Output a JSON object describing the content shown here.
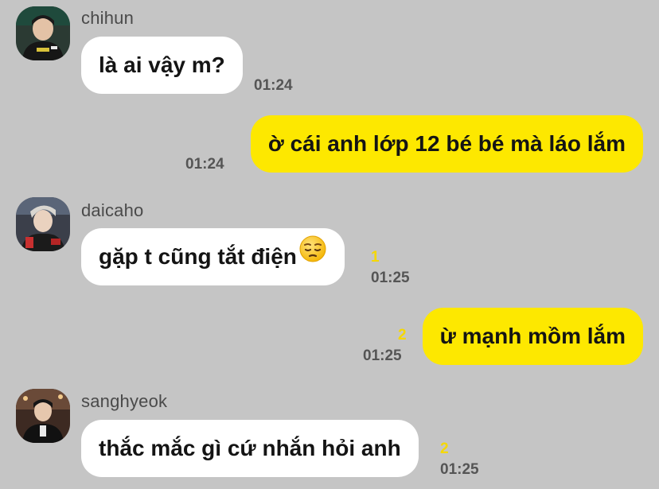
{
  "messages": [
    {
      "sender": "chihun",
      "text": "là ai vậy m?",
      "time": "01:24"
    },
    {
      "text": "ờ cái anh lớp 12 bé bé mà láo lắm",
      "time": "01:24"
    },
    {
      "sender": "daicaho",
      "text": "gặp t cũng tắt điện",
      "emoji": "pensive-face",
      "unread": "1",
      "time": "01:25"
    },
    {
      "text": "ừ mạnh mồm lắm",
      "unread": "2",
      "time": "01:25"
    },
    {
      "sender": "sanghyeok",
      "text": "thắc mắc gì cứ nhắn hỏi anh",
      "unread": "2",
      "time": "01:25"
    }
  ],
  "colors": {
    "background": "#c5c5c5",
    "incoming_bubble": "#ffffff",
    "outgoing_bubble": "#fde800",
    "unread_count": "#f5d800"
  }
}
